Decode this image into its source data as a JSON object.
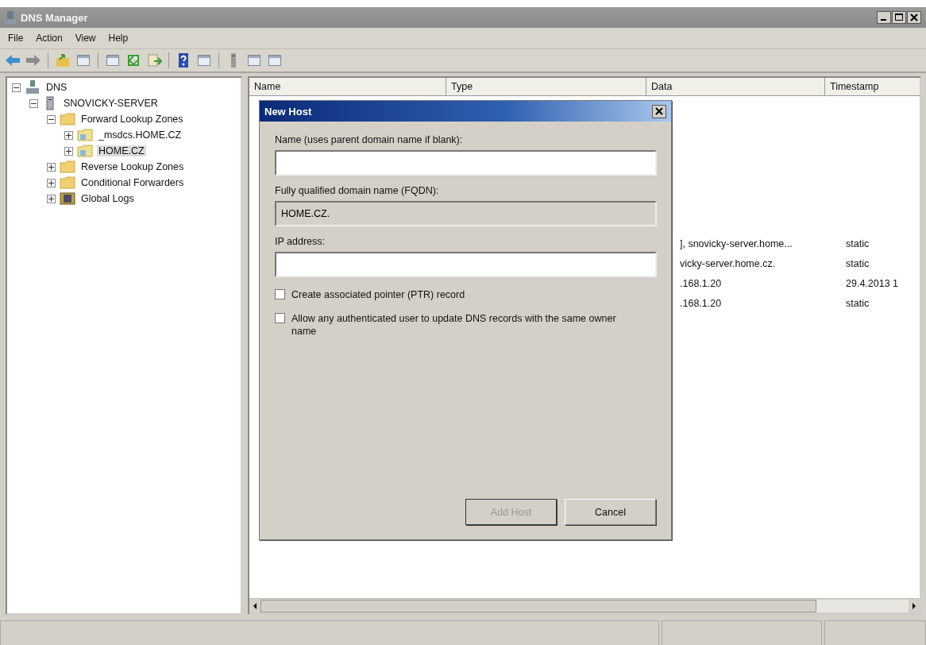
{
  "window": {
    "title": "DNS Manager"
  },
  "menu": [
    "File",
    "Action",
    "View",
    "Help"
  ],
  "tree": [
    {
      "label": "DNS",
      "kind": "dns",
      "expanded": true,
      "selected": false,
      "children": [
        {
          "label": "SNOVICKY-SERVER",
          "kind": "server",
          "expanded": true,
          "selected": false,
          "children": [
            {
              "label": "Forward Lookup Zones",
              "kind": "folder",
              "expanded": true,
              "selected": false,
              "children": [
                {
                  "label": "_msdcs.HOME.CZ",
                  "kind": "zone",
                  "expanded": false,
                  "selected": false
                },
                {
                  "label": "HOME.CZ",
                  "kind": "zone",
                  "expanded": false,
                  "selected": true
                }
              ]
            },
            {
              "label": "Reverse Lookup Zones",
              "kind": "folder",
              "expanded": false,
              "selected": false
            },
            {
              "label": "Conditional Forwarders",
              "kind": "folder",
              "expanded": false,
              "selected": false
            },
            {
              "label": "Global Logs",
              "kind": "log",
              "expanded": false,
              "selected": false
            }
          ]
        }
      ]
    }
  ],
  "table": {
    "columns": [
      "Name",
      "Type",
      "Data",
      "Timestamp"
    ],
    "rows": [
      {
        "data": "], snovicky-server.home...",
        "timestamp": "static"
      },
      {
        "data": "vicky-server.home.cz.",
        "timestamp": "static"
      },
      {
        "data": ".168.1.20",
        "timestamp": "29.4.2013 1"
      },
      {
        "data": ".168.1.20",
        "timestamp": "static"
      }
    ]
  },
  "dialog": {
    "title": "New Host",
    "name_label": "Name (uses parent domain name if blank):",
    "fqdn_label": "Fully qualified domain name (FQDN):",
    "fqdn_value": "HOME.CZ.",
    "ip_label": "IP address:",
    "checkboxes": [
      {
        "label": "Create associated pointer (PTR) record",
        "checked": false
      },
      {
        "label": "Allow any authenticated user to update DNS records with the same owner name",
        "checked": false
      }
    ],
    "buttons": [
      {
        "label": "Add Host",
        "disabled": true
      },
      {
        "label": "Cancel",
        "disabled": false
      }
    ]
  }
}
